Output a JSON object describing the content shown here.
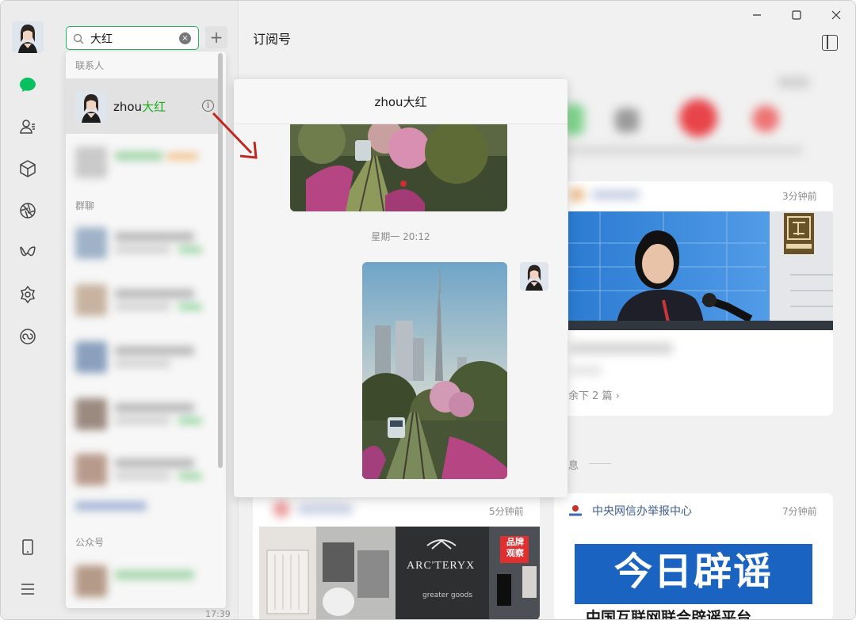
{
  "window": {
    "title": "订阅号",
    "controls": [
      "minimize",
      "maximize",
      "close"
    ]
  },
  "nav": {
    "items": [
      "chat-icon",
      "contacts-icon",
      "favorites-icon",
      "moments-icon",
      "channels-icon",
      "mini-programs-icon",
      "search-discover-icon",
      "phone-icon",
      "menu-icon"
    ],
    "accent": "#07c160"
  },
  "search": {
    "value": "大红",
    "clear_label": "×",
    "add_label": "+"
  },
  "results": {
    "contacts_title": "联系人",
    "contact": {
      "name_prefix": "zhou",
      "name_highlight": "大红"
    },
    "groups_title": "群聊",
    "official_title": "公众号",
    "bottom_time": "17:39"
  },
  "popup": {
    "title": "zhou大红",
    "timestamp": "星期一 20:12"
  },
  "feed": {
    "article_time": "3分钟前",
    "remaining": "余下 2 篇 ›",
    "section_label": "息",
    "card_left_time": "5分钟前",
    "card_right_publisher": "中央网信办举报中心",
    "card_right_time": "7分钟前",
    "banner_text": "今日辟谣",
    "banner_subtext": "中国互联网联合辟谣平台",
    "brand_text": "ARC'TERYX",
    "brand_sub": "greater goods",
    "badge_line1": "品牌",
    "badge_line2": "观察"
  },
  "colors": {
    "highlight": "#1aad19",
    "search_border": "#22b35c",
    "annotation_arrow": "#c0271f",
    "link_blue": "#3d5d8f"
  }
}
